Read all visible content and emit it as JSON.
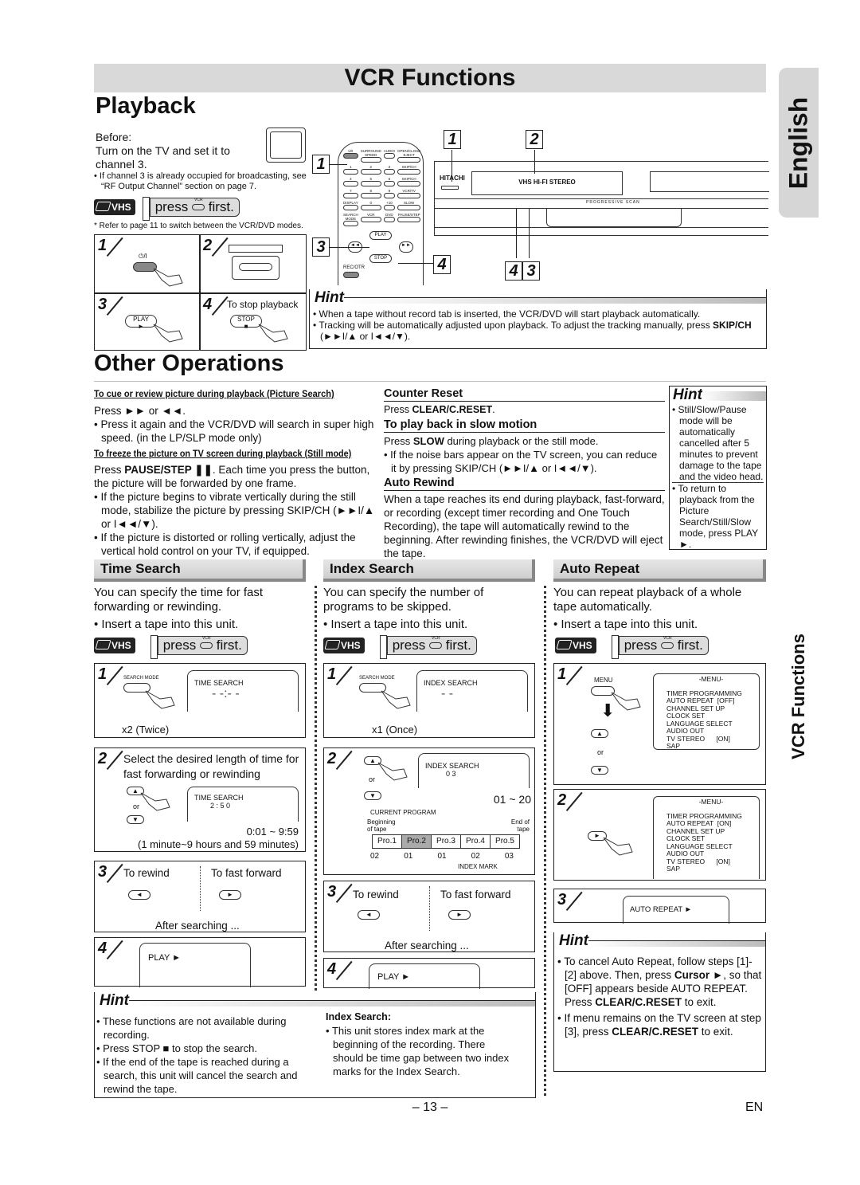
{
  "header": {
    "title": "VCR Functions",
    "section": "Playback",
    "language_tab": "English",
    "side_tab": "VCR Functions"
  },
  "playback": {
    "before": [
      "Before:",
      "Turn on the TV and set it to",
      "channel 3."
    ],
    "before_note": "If channel 3 is already occupied for broadcasting, see “RF Output Channel” section on page 7.",
    "vhs": "VHS",
    "press": "press",
    "vcr_key": "VCR",
    "first": "first.",
    "mode_note": "* Refer to page 11 to switch between the VCR/DVD modes.",
    "steps": [
      {
        "n": "1",
        "label": "⏻/I"
      },
      {
        "n": "2",
        "label": ""
      },
      {
        "n": "3",
        "label": "PLAY"
      },
      {
        "n": "4",
        "label": "To stop playback",
        "button": "STOP"
      }
    ],
    "remote": {
      "callouts": [
        "1",
        "3"
      ],
      "buttons": [
        "⏻/I",
        "SURROUND SPEED",
        "AUDIO",
        "OPEN/CLOSE EJECT",
        "1",
        "2",
        "3",
        "SKIP/CH",
        "4",
        "5",
        "6",
        "SKIP/CH",
        "7",
        "8",
        "9",
        "VCR/TV",
        "DISPLAY",
        "0",
        "+10",
        "SLOW",
        "SEARCH MODE",
        "VCR",
        "DVD",
        "PAUSE/STEP",
        "PLAY",
        "STOP",
        "REC/OTR"
      ]
    },
    "unit": {
      "brand": "HITACHI",
      "logo": "VHS HI-FI STEREO",
      "panel": "PROGRESSIVE SCAN",
      "callouts": [
        "1",
        "2",
        "4",
        "4",
        "3"
      ]
    },
    "hint": {
      "title": "Hint",
      "items": [
        "When a tape without record tab is inserted, the VCR/DVD will start playback automatically.",
        "Tracking will be automatically adjusted upon playback. To adjust the tracking manually, press"
      ],
      "skip": "SKIP/CH",
      "skip_rest": " (►►I/▲ or I◄◄/▼)."
    }
  },
  "other": {
    "title": "Other Operations",
    "picture_search": {
      "heading": "To cue or review picture during playback (Picture Search)",
      "line": "Press ►► or ◄◄.",
      "items": [
        "Press it again and the VCR/DVD will search in super high speed. (in the LP/SLP mode only)"
      ]
    },
    "still": {
      "heading": "To freeze the picture on TV screen during playback (Still mode)",
      "p1": "Press ",
      "p1b": "PAUSE/STEP ❚❚",
      "p1r": ". Each time you press the button, the picture will be forwarded by one frame.",
      "items": [
        "If the picture begins to vibrate vertically during the still mode, stabilize the picture by pressing SKIP/CH (►►I/▲ or I◄◄/▼).",
        "If the picture is distorted or rolling vertically, adjust the vertical hold control on your TV, if equipped."
      ]
    },
    "counter": {
      "heading": "Counter Reset",
      "p": "Press ",
      "pb": "CLEAR/C.RESET",
      "pr": "."
    },
    "slow": {
      "heading": "To play back in slow motion",
      "p": "Press ",
      "pb": "SLOW",
      "pr": " during playback or the still mode.",
      "item": "If the noise bars appear on the TV screen, you can reduce it by pressing SKIP/CH (►►I/▲ or I◄◄/▼)."
    },
    "rewind": {
      "heading": "Auto Rewind",
      "p": "When a tape reaches its end during playback, fast-forward, or recording (except timer recording and One Touch Recording), the tape will automatically rewind to the beginning. After rewinding finishes, the VCR/DVD will eject the tape."
    },
    "hint": {
      "title": "Hint",
      "items": [
        "Still/Slow/Pause mode will be automatically cancelled after 5 minutes to prevent damage to the tape and the video head.",
        "To return to playback from the Picture Search/Still/Slow mode, press PLAY ►."
      ]
    }
  },
  "time_search": {
    "heading": "Time Search",
    "desc": "You can specify the time for fast forwarding or rewinding.",
    "insert": "Insert a tape into this unit.",
    "s1": {
      "button": "SEARCH MODE",
      "screen": "TIME SEARCH",
      "note": "x2 (Twice)"
    },
    "s2": {
      "text": "Select the desired length of time for fast forwarding or rewinding",
      "screen": "TIME SEARCH",
      "value": "2 : 5 0",
      "or": "or",
      "range": "0:01 ~ 9:59",
      "range_note": "(1 minute~9 hours and 59 minutes)"
    },
    "s3": {
      "rewind": "To rewind",
      "ff": "To fast forward",
      "after": "After searching ..."
    },
    "s4": {
      "screen": "PLAY ►"
    }
  },
  "index_search": {
    "heading": "Index Search",
    "desc": "You can specify the number of programs to be skipped.",
    "insert": "Insert a tape into this unit.",
    "s1": {
      "button": "SEARCH MODE",
      "screen": "INDEX SEARCH",
      "note": "x1 (Once)"
    },
    "s2": {
      "screen": "INDEX SEARCH",
      "value": "0 3",
      "or": "or",
      "range": "01 ~ 20",
      "current": "CURRENT PROGRAM",
      "begin": "Beginning of tape",
      "end": "End of tape",
      "programs": [
        "Pro.1",
        "Pro.2",
        "Pro.3",
        "Pro.4",
        "Pro.5"
      ],
      "marks": [
        "02",
        "01",
        "01",
        "02",
        "03"
      ],
      "mark_label": "INDEX MARK"
    },
    "s3": {
      "rewind": "To rewind",
      "ff": "To fast forward",
      "after": "After searching ..."
    },
    "s4": {
      "screen": "PLAY ►"
    }
  },
  "auto_repeat": {
    "heading": "Auto Repeat",
    "desc": "You can repeat playback of a whole tape automatically.",
    "insert": "Insert a tape into this unit.",
    "s1": {
      "button": "MENU",
      "or": "or",
      "menu_title": "-MENU-",
      "menu": [
        "TIMER PROGRAMMING",
        "AUTO REPEAT  [OFF]",
        "CHANNEL SET UP",
        "CLOCK SET",
        "LANGUAGE SELECT",
        "AUDIO OUT",
        "TV STEREO      [ON]",
        "SAP"
      ]
    },
    "s2": {
      "menu_title": "-MENU-",
      "menu": [
        "TIMER PROGRAMMING",
        "AUTO REPEAT  [ON]",
        "CHANNEL SET UP",
        "CLOCK SET",
        "LANGUAGE SELECT",
        "AUDIO OUT",
        "TV STEREO      [ON]",
        "SAP"
      ]
    },
    "s3": {
      "screen": "AUTO REPEAT ►"
    },
    "hint": {
      "title": "Hint",
      "i1a": "To cancel Auto Repeat, follow steps [1]-[2] above. Then, press ",
      "i1b": "Cursor ►",
      "i1c": ", so that [OFF] appears beside AUTO REPEAT.  Press ",
      "i1d": "CLEAR/C.RESET",
      "i1e": " to exit.",
      "i2a": "If menu remains on the TV screen at step [3], press ",
      "i2b": "CLEAR/C.RESET",
      "i2c": " to exit."
    }
  },
  "bottom_hint": {
    "title": "Hint",
    "items": [
      "These functions are not available during recording.",
      "Press STOP ■ to stop the search.",
      "If the end of the tape is reached during a search, this unit will cancel the search and rewind the tape."
    ],
    "index_title": "Index Search:",
    "index_items": [
      "This unit stores index mark at the beginning of the recording. There should be time gap between two index marks for the Index Search."
    ]
  },
  "footer": {
    "page": "– 13 –",
    "lang": "EN"
  }
}
